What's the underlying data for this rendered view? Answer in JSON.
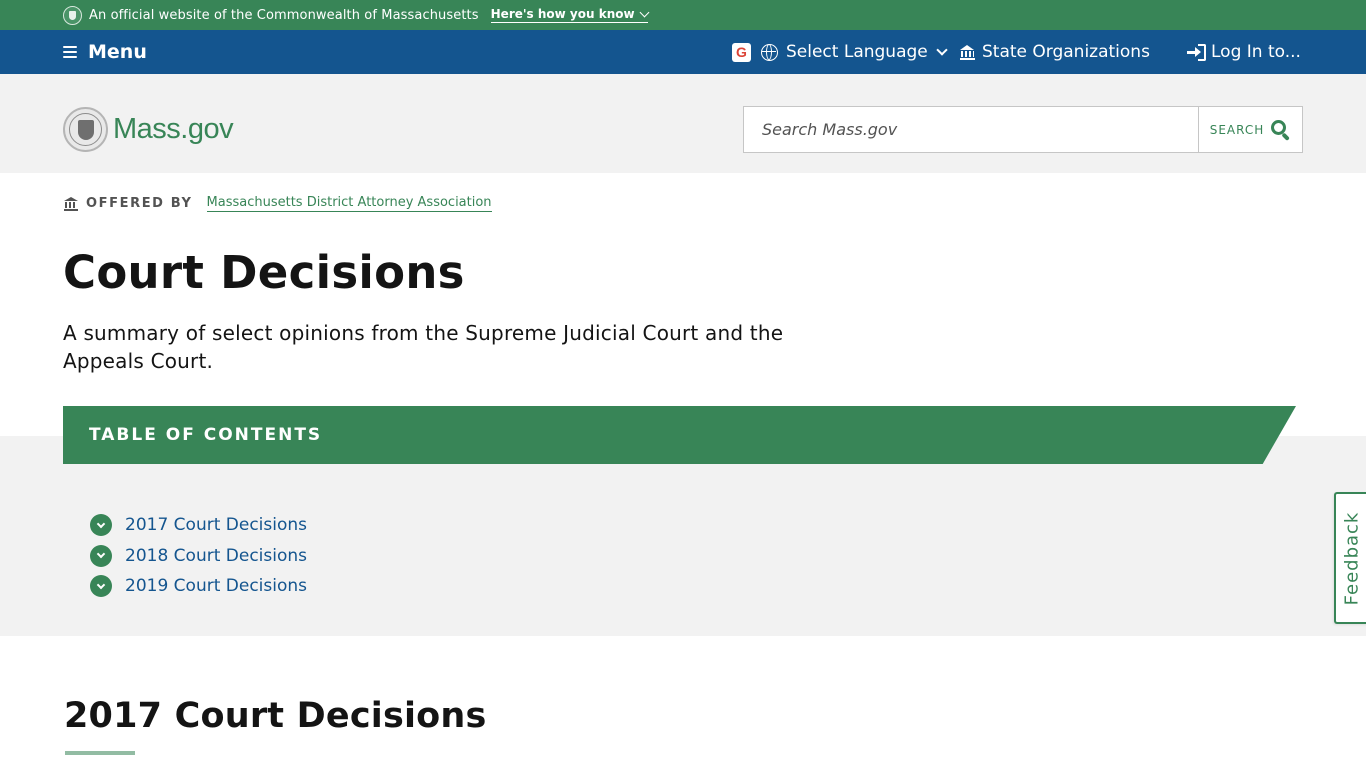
{
  "official_banner": {
    "text": "An official website of the Commonwealth of Massachusetts",
    "how_link": "Here's how you know"
  },
  "util_nav": {
    "menu_label": "Menu",
    "google_badge": "G",
    "language_label": "Select Language",
    "state_orgs_label": "State Organizations",
    "login_label": "Log In to..."
  },
  "header": {
    "logo_text": "Mass.gov",
    "search_placeholder": "Search Mass.gov",
    "search_button_label": "SEARCH"
  },
  "offered_by": {
    "label": "OFFERED BY",
    "org": "Massachusetts District Attorney Association"
  },
  "page": {
    "title": "Court Decisions",
    "subtitle": "A summary of select opinions from the Supreme Judicial Court and the Appeals Court."
  },
  "toc": {
    "title": "TABLE OF CONTENTS",
    "items": [
      {
        "label": "2017 Court Decisions"
      },
      {
        "label": "2018 Court Decisions"
      },
      {
        "label": "2019 Court Decisions"
      }
    ]
  },
  "feedback_label": "Feedback",
  "section": {
    "heading": "2017 Court Decisions"
  },
  "colors": {
    "green": "#388557",
    "blue": "#14558f",
    "gray_bg": "#f2f2f2"
  },
  "icons": {
    "banner": "seal-icon",
    "menu": "hamburger-icon",
    "language": "globe-icon",
    "state_orgs": "building-icon",
    "login": "sign-in-icon",
    "search": "search-icon",
    "toc_bullet": "chevron-down-circle-icon"
  }
}
